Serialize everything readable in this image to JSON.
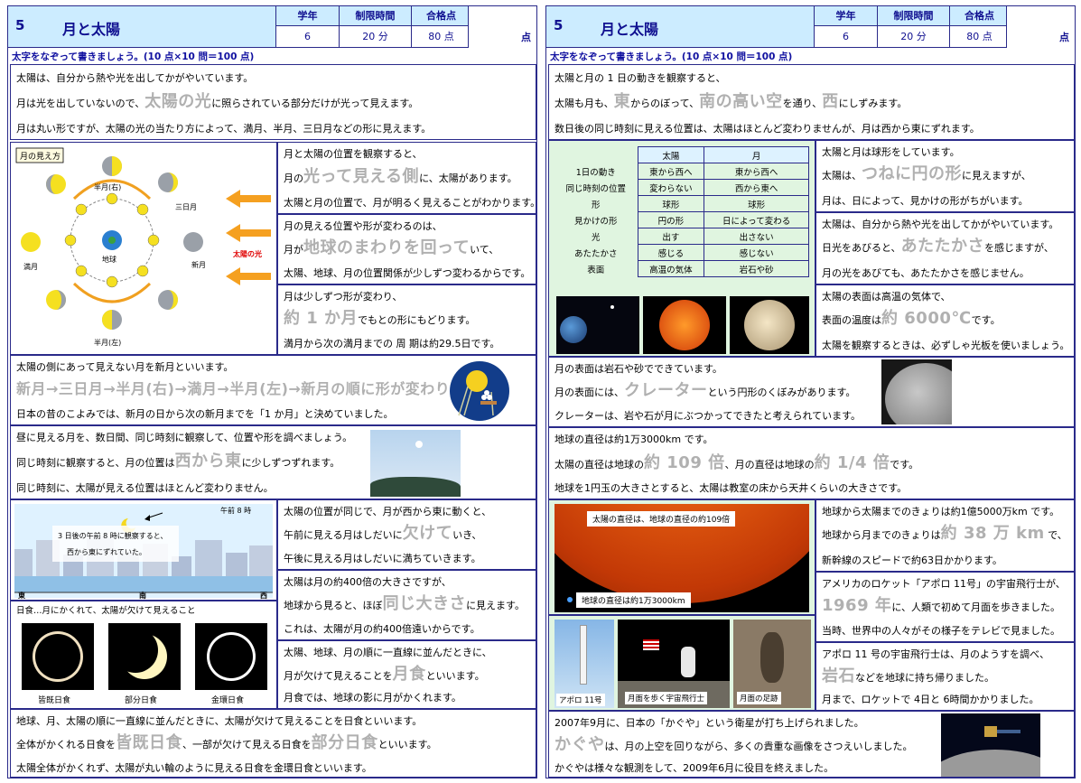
{
  "left": {
    "header": {
      "number": "5",
      "title": "月と太陽",
      "grade_label": "学年",
      "grade_value": "6",
      "time_label": "制限時間",
      "time_value": "20 分",
      "pass_label": "合格点",
      "pass_value": "80 点",
      "score_unit": "点"
    },
    "instruction": "太字をなぞって書きましょう。(10 点×10 問＝100 点)",
    "intro": [
      {
        "pre": "太陽は、自分から熱や光を出してかがやいています。",
        "big": "",
        "post": ""
      },
      {
        "pre": "月は光を出していないので、",
        "big": "太陽の光",
        "post": "に照らされている部分だけが光って見えます。"
      },
      {
        "pre": "月は丸い形ですが、太陽の光の当たり方によって、満月、半月、三日月などの形に見えます。",
        "big": "",
        "post": ""
      }
    ],
    "phase_fig": {
      "title": "月の見え方",
      "half_right": "半月(右)",
      "crescent": "三日月",
      "full": "満月",
      "earth": "地球",
      "new": "新月",
      "half_left": "半月(左)",
      "sunlight": "太陽の光"
    },
    "phase_text": [
      {
        "l1": "月と太陽の位置を観察すると、",
        "l2pre": "月の",
        "l2big": "光って見える側",
        "l2post": "に、太陽があります。",
        "l3": "太陽と月の位置で、月が明るく見えることがわかります。"
      },
      {
        "l1": "月の見える位置や形が変わるのは、",
        "l2pre": "月が",
        "l2big": "地球のまわりを回って",
        "l2post": "いて、",
        "l3": "太陽、地球、月の位置関係が少しずつ変わるからです。"
      },
      {
        "l1": "月は少しずつ形が変わり、",
        "l2pre": "",
        "l2big": "約 1 か月",
        "l2post": "でもとの形にもどります。",
        "l3": "満月から次の満月までの 周 期は約29.5日です。"
      }
    ],
    "newmoon": {
      "l1": "太陽の側にあって見えない月を新月といいます。",
      "big": "新月→三日月→半月(右)→満月→半月(左)→新月の順に形が変わります。",
      "l3": "日本の昔のこよみでは、新月の日から次の新月までを「1 か月」と決めていました。"
    },
    "daymoon": {
      "l1": "昼に見える月を、数日間、同じ時刻に観察して、位置や形を調べましょう。",
      "l2pre": "同じ時刻に観察すると、月の位置は",
      "l2big": "西から東",
      "l2post": "に少しずつずれます。",
      "l3": "同じ時刻に、太陽が見える位置はほとんど変わりません。"
    },
    "city_fig": {
      "time": "午前 8 時",
      "note1": "3 日後の午前 8 時に観察すると、",
      "note2": "西から東にずれていた。",
      "east": "東",
      "south": "南",
      "west": "西"
    },
    "moving_text": {
      "l1": "太陽の位置が同じで、月が西から東に動くと、",
      "l2pre": "午前に見える月はしだいに",
      "l2big": "欠けて",
      "l2post": "いき、",
      "l3": "午後に見える月はしだいに満ちていきます。"
    },
    "size_text": {
      "l1": "太陽は月の約400倍の大きさですが、",
      "l2pre": "地球から見ると、ほぼ",
      "l2big": "同じ大きさ",
      "l2post": "に見えます。",
      "l3": "これは、太陽が月の約400倍遠いからです。"
    },
    "eclipse_fig": {
      "title": "日食…月にかくれて、太陽が欠けて見えること",
      "total": "皆既日食",
      "partial": "部分日食",
      "annular": "金環日食"
    },
    "lunar_text": {
      "l1": "太陽、地球、月の順に一直線に並んだときに、",
      "l2pre": "月が欠けて見えることを",
      "l2big": "月食",
      "l2post": "といいます。",
      "l3": "月食では、地球の影に月がかくれます。"
    },
    "solar_text": {
      "l1": "地球、月、太陽の順に一直線に並んだときに、太陽が欠けて見えることを日食といいます。",
      "l2pre": "全体がかくれる日食を",
      "l2big": "皆既日食",
      "l2mid": "、一部が欠けて見える日食を",
      "l2big2": "部分日食",
      "l2post": "といいます。",
      "l3": "太陽全体がかくれず、太陽が丸い輪のように見える日食を金環日食といいます。"
    }
  },
  "right": {
    "header": {
      "number": "5",
      "title": "月と太陽",
      "grade_label": "学年",
      "grade_value": "6",
      "time_label": "制限時間",
      "time_value": "20 分",
      "pass_label": "合格点",
      "pass_value": "80 点",
      "score_unit": "点"
    },
    "instruction": "太字をなぞって書きましょう。(10 点×10 問＝100 点)",
    "intro": {
      "l1": "太陽と月の 1 日の動きを観察すると、",
      "l2pre": "太陽も月も、",
      "l2big1": "東",
      "l2a": "からのぼって、",
      "l2big2": "南の高い空",
      "l2b": "を通り、",
      "l2big3": "西",
      "l2post": "にしずみます。",
      "l3": "数日後の同じ時刻に見える位置は、太陽はほとんど変わりませんが、月は西から東にずれます。"
    },
    "table": {
      "head_sun": "太陽",
      "head_moon": "月",
      "rows": [
        {
          "label": "1日の動き",
          "sun": "東から西へ",
          "moon": "東から西へ"
        },
        {
          "label": "同じ時刻の位置",
          "sun": "変わらない",
          "moon": "西から東へ"
        },
        {
          "label": "形",
          "sun": "球形",
          "moon": "球形"
        },
        {
          "label": "見かけの形",
          "sun": "円の形",
          "moon": "日によって変わる"
        },
        {
          "label": "光",
          "sun": "出す",
          "moon": "出さない"
        },
        {
          "label": "あたたかさ",
          "sun": "感じる",
          "moon": "感じない"
        },
        {
          "label": "表面",
          "sun": "高温の気体",
          "moon": "岩石や砂"
        }
      ]
    },
    "sun_text": [
      {
        "l1": "太陽と月は球形をしています。",
        "l2pre": "太陽は、",
        "l2big": "つねに円の形",
        "l2post": "に見えますが、",
        "l3": "月は、日によって、見かけの形がちがいます。"
      },
      {
        "l1": "太陽は、自分から熱や光を出してかがやいています。",
        "l2pre": "日光をあびると、",
        "l2big": "あたたかさ",
        "l2post": "を感じますが、",
        "l3": "月の光をあびても、あたたかさを感じません。"
      },
      {
        "l1": "太陽の表面は高温の気体で、",
        "l2pre": "表面の温度は",
        "l2big": "約 6000℃",
        "l2post": "です。",
        "l3": "太陽を観察するときは、必ずしゃ光板を使いましょう。"
      }
    ],
    "crater": {
      "l1": "月の表面は岩石や砂でできています。",
      "l2pre": "月の表面には、",
      "l2big": "クレーター",
      "l2post": "という円形のくぼみがあります。",
      "l3": "クレーターは、岩や石が月にぶつかってできたと考えられています。"
    },
    "diameter": {
      "l1": "地球の直径は約1万3000km です。",
      "l2pre": "太陽の直径は地球の",
      "l2big1": "約 109 倍",
      "l2mid": "、月の直径は地球の",
      "l2big2": "約 1/4 倍",
      "l2post": "です。",
      "l3": "地球を1円玉の大きさとすると、太陽は教室の床から天井くらいの大きさです。"
    },
    "sun_fig": {
      "sun_label": "太陽の直径は、地球の直径の約109倍",
      "earth_label": "地球の直径は約1万3000km"
    },
    "distance": {
      "l1": "地球から太陽までのきょりは約1億5000万km です。",
      "l2pre": "地球から月までのきょりは",
      "l2big": "約 38 万 km",
      "l2post": " で、",
      "l3": "新幹線のスピードで約63日かかります。"
    },
    "apollo": {
      "l1": "アメリカのロケット「アポロ 11号」の宇宙飛行士が、",
      "l2big": "1969 年",
      "l2post": "に、人類で初めて月面を歩きました。",
      "l3": "当時、世界中の人々がその様子をテレビで見ました。"
    },
    "rock": {
      "l1": "アポロ 11 号の宇宙飛行士は、月のようすを調べ、",
      "l2big": "岩石",
      "l2post": "などを地球に持ち帰りました。",
      "l3": "月まで、ロケットで 4日と 6時間かかりました。"
    },
    "photos": {
      "rocket": "アポロ 11号",
      "astronaut": "月面を歩く宇宙飛行士",
      "footprint": "月面の足跡"
    },
    "kaguya": {
      "l1": "2007年9月に、日本の「かぐや」という衛星が打ち上げられました。",
      "big": "かぐや",
      "l2post": "は、月の上空を回りながら、多くの貴重な画像をさつえいしました。",
      "l3": "かぐやは様々な観測をして、2009年6月に役目を終えました。"
    }
  }
}
